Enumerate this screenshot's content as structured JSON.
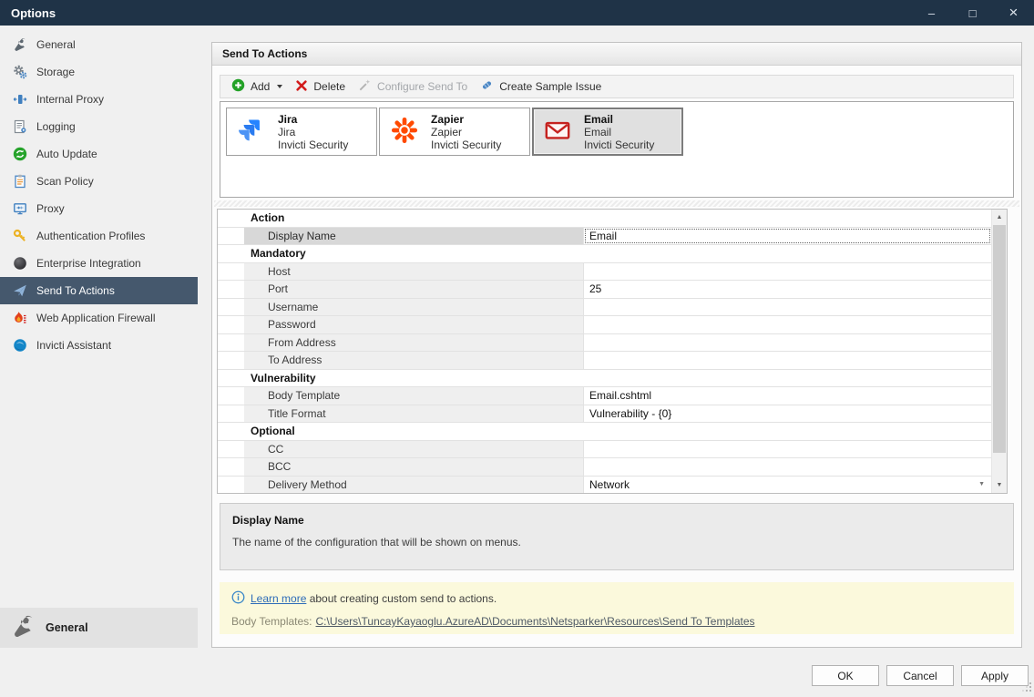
{
  "window": {
    "title": "Options",
    "controls": {
      "minimize": "–",
      "maximize": "□",
      "close": "×"
    }
  },
  "sidebar": {
    "items": [
      {
        "label": "General",
        "icon": "wrench-icon",
        "selected": false
      },
      {
        "label": "Storage",
        "icon": "gears-icon",
        "selected": false
      },
      {
        "label": "Internal Proxy",
        "icon": "internal-proxy-icon",
        "selected": false
      },
      {
        "label": "Logging",
        "icon": "log-document-icon",
        "selected": false
      },
      {
        "label": "Auto Update",
        "icon": "refresh-icon",
        "selected": false
      },
      {
        "label": "Scan Policy",
        "icon": "clipboard-icon",
        "selected": false
      },
      {
        "label": "Proxy",
        "icon": "monitor-icon",
        "selected": false
      },
      {
        "label": "Authentication Profiles",
        "icon": "key-icon",
        "selected": false
      },
      {
        "label": "Enterprise Integration",
        "icon": "sphere-icon",
        "selected": false
      },
      {
        "label": "Send To Actions",
        "icon": "paper-plane-icon",
        "selected": true
      },
      {
        "label": "Web Application Firewall",
        "icon": "flame-icon",
        "selected": false
      },
      {
        "label": "Invicti Assistant",
        "icon": "assistant-globe-icon",
        "selected": false
      }
    ],
    "footer": {
      "label": "General",
      "icon": "wrench-icon"
    }
  },
  "panel": {
    "header": "Send To Actions",
    "toolbar": {
      "add": "Add",
      "delete": "Delete",
      "configure": "Configure Send To",
      "create_sample": "Create Sample Issue"
    },
    "actions": [
      {
        "title": "Jira",
        "subtitle": "Jira",
        "vendor": "Invicti Security",
        "icon": "jira-logo-icon",
        "selected": false
      },
      {
        "title": "Zapier",
        "subtitle": "Zapier",
        "vendor": "Invicti Security",
        "icon": "zapier-logo-icon",
        "selected": false
      },
      {
        "title": "Email",
        "subtitle": "Email",
        "vendor": "Invicti Security",
        "icon": "email-envelope-icon",
        "selected": true
      }
    ],
    "properties": [
      {
        "type": "section",
        "label": "Action"
      },
      {
        "type": "row",
        "label": "Display Name",
        "value": "Email",
        "selected": true
      },
      {
        "type": "section",
        "label": "Mandatory"
      },
      {
        "type": "row",
        "label": "Host",
        "value": ""
      },
      {
        "type": "row",
        "label": "Port",
        "value": "25"
      },
      {
        "type": "row",
        "label": "Username",
        "value": ""
      },
      {
        "type": "row",
        "label": "Password",
        "value": ""
      },
      {
        "type": "row",
        "label": "From Address",
        "value": ""
      },
      {
        "type": "row",
        "label": "To Address",
        "value": ""
      },
      {
        "type": "section",
        "label": "Vulnerability"
      },
      {
        "type": "row",
        "label": "Body Template",
        "value": "Email.cshtml"
      },
      {
        "type": "row",
        "label": "Title Format",
        "value": "Vulnerability - {0}"
      },
      {
        "type": "section",
        "label": "Optional"
      },
      {
        "type": "row",
        "label": "CC",
        "value": ""
      },
      {
        "type": "row",
        "label": "BCC",
        "value": ""
      },
      {
        "type": "row",
        "label": "Delivery Method",
        "value": "Network",
        "dropdown": true
      }
    ],
    "description": {
      "title": "Display Name",
      "text": "The name of the configuration that will be shown on menus."
    },
    "info": {
      "learn_more": "Learn more",
      "learn_more_rest": " about creating custom send to actions.",
      "body_templates_label": "Body Templates:",
      "body_templates_path": "C:\\Users\\TuncayKayaoglu.AzureAD\\Documents\\Netsparker\\Resources\\Send To Templates"
    }
  },
  "footer_buttons": {
    "ok": "OK",
    "cancel": "Cancel",
    "apply": "Apply"
  },
  "colors": {
    "titlebar": "#1f3347",
    "sidebar_selected": "#45586d",
    "info_background": "#fbf9dc",
    "link": "#2e6cb8",
    "add_green": "#23a127",
    "delete_red": "#d21b1b",
    "jira_blue": "#2684ff",
    "zapier_orange": "#ff4a00",
    "email_red": "#c5221f"
  }
}
